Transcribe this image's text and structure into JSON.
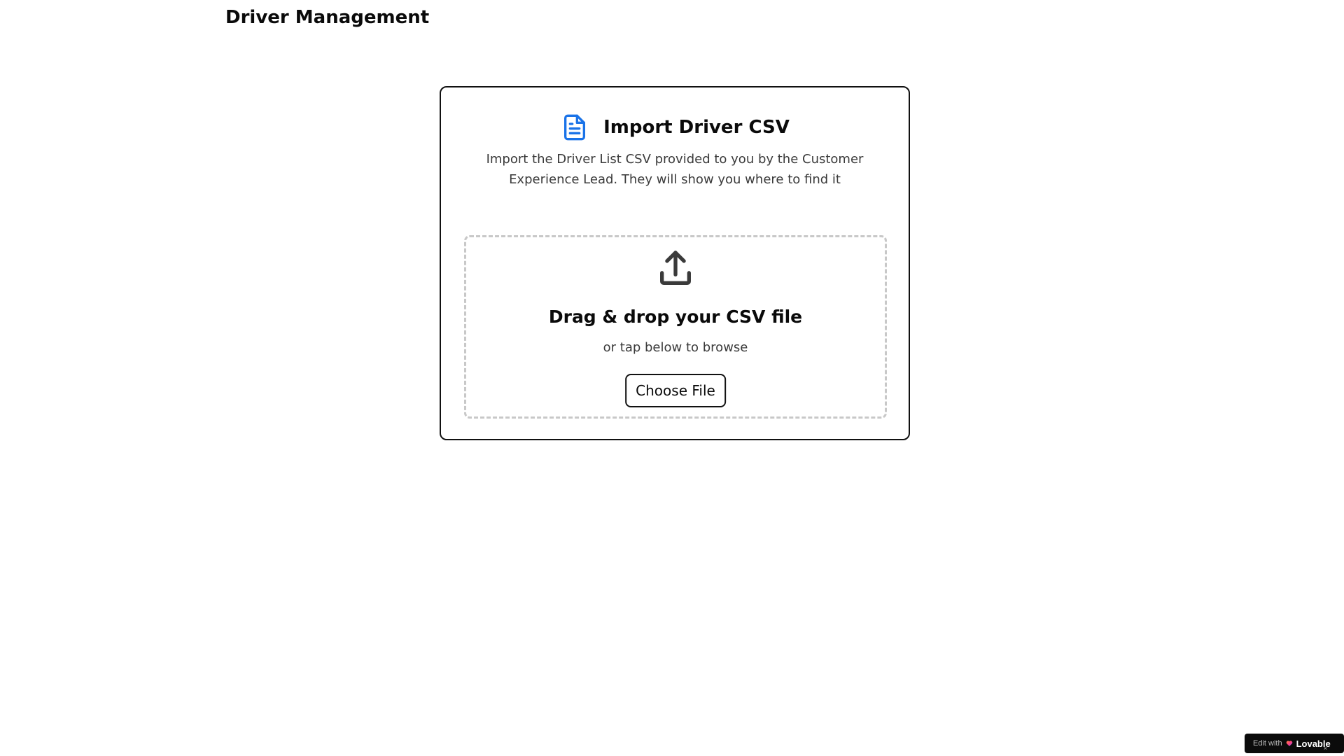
{
  "header": {
    "title": "Driver Management"
  },
  "import_card": {
    "title": "Import Driver CSV",
    "title_icon": "file-text-icon",
    "description": "Import the Driver List CSV provided to you by the Customer Experience Lead. They will show you where to find it",
    "dropzone": {
      "icon": "upload-icon",
      "title": "Drag & drop your CSV file",
      "subtitle": "or tap below to browse",
      "button_label": "Choose File"
    }
  },
  "badge": {
    "prefix": "Edit with",
    "brand": "Lovable",
    "close": "×"
  },
  "colors": {
    "accent_blue": "#1a73e8",
    "text_dark": "#0a0a0a",
    "text_muted": "#3a3a3a",
    "dashed_border": "#c8c8c8",
    "badge_bg": "#0b0b0b"
  }
}
